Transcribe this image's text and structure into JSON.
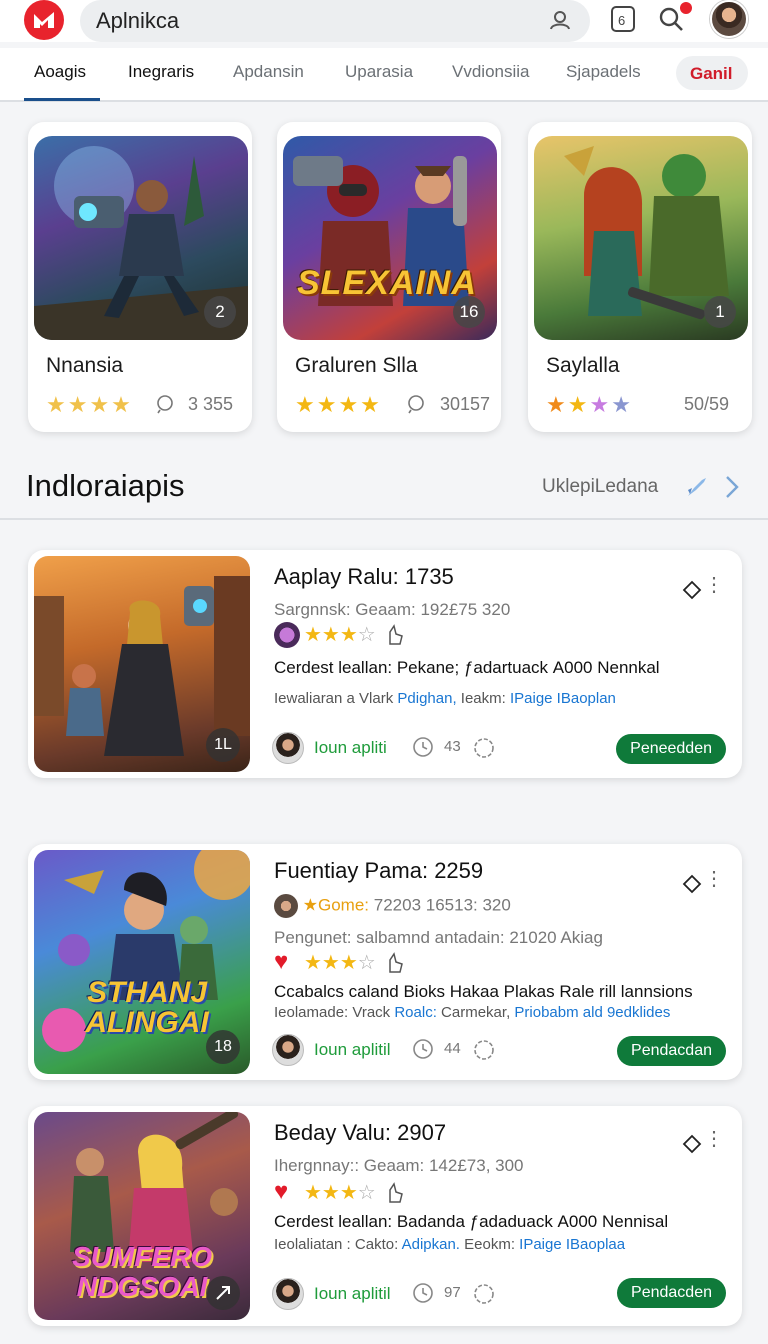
{
  "header": {
    "search_text": "Aplnikca",
    "icons": [
      "brand-logo",
      "profile-icon",
      "tablet-icon",
      "search-icon",
      "notification-dot",
      "user-avatar"
    ],
    "accent": "#e8232d"
  },
  "tabs": [
    {
      "label": "Aoagis",
      "active": true
    },
    {
      "label": "Inegraris"
    },
    {
      "label": "Apdansin"
    },
    {
      "label": "Uparasia"
    },
    {
      "label": "Vvdionsiia"
    },
    {
      "label": "Sjapadels"
    },
    {
      "label": "Ganil",
      "pill": true
    }
  ],
  "featured": [
    {
      "title": "Nnansia",
      "rank": "2",
      "count": "3 355",
      "rating": 4
    },
    {
      "title": "Graluren Slla",
      "rank": "16",
      "count": "30157",
      "rating": 4,
      "logo_text": "SLEXAINA"
    },
    {
      "title": "Saylalla",
      "rank": "1",
      "count": "50/59",
      "rating": 4
    }
  ],
  "section": {
    "title": "Indloraiapis",
    "link": "UklepiLedana"
  },
  "cards": [
    {
      "title": "Aaplay Ralu:  1735",
      "meta": "Sargnnsk: Geaam: 192£75 320",
      "rating": 3,
      "desc": "Cerdest leallan: Pekane; ƒadartuack А000 Nennkal",
      "link_prefix": "Iewaliaran a Vlark",
      "link_a": "Pdighan,",
      "link_mid": "Ieakm:",
      "link_b": "IPaige IBaoplan",
      "author": "Ioun apliti",
      "comments": "43",
      "button": "Peneedden",
      "rank": "1L"
    },
    {
      "title": "Fuentiay Pama: 2259",
      "meta_badge": "Gome:",
      "meta": "72203  16513: 320",
      "meta2": "Pengunet: salbamnd antadain: 21020 Akiag",
      "rating": 3,
      "desc": "Ccabalcs caland Bioks Hakaa Plakas Rale rill lannsions",
      "link_prefix": "Ieolamade:  Vrack",
      "link_a": "Roalc:",
      "link_mid": "Carmekar,",
      "link_b": "Priobabm ald 9edklides",
      "author": "Ioun aplitil",
      "comments": "44",
      "button": "Pendacdan",
      "rank": "18",
      "logo_text": "STHANJ ALINGAI"
    },
    {
      "title": "Beday Valu: 2907",
      "meta": "Ihergnnay:: Geaam: 142£73, 300",
      "rating": 3,
      "desc": "Cerdest leallan: Badanda ƒadaduack А000 Nennisal",
      "link_prefix": "Ieolaliatan : Cakto:",
      "link_a": "Adipkan.",
      "link_mid": "Eeokm:",
      "link_b": "IPaige IBaoplaa",
      "author": "Ioun aplitil",
      "comments": "97",
      "button": "Pendacden",
      "logo_text": "SUMFERO NDGSOAI"
    }
  ]
}
